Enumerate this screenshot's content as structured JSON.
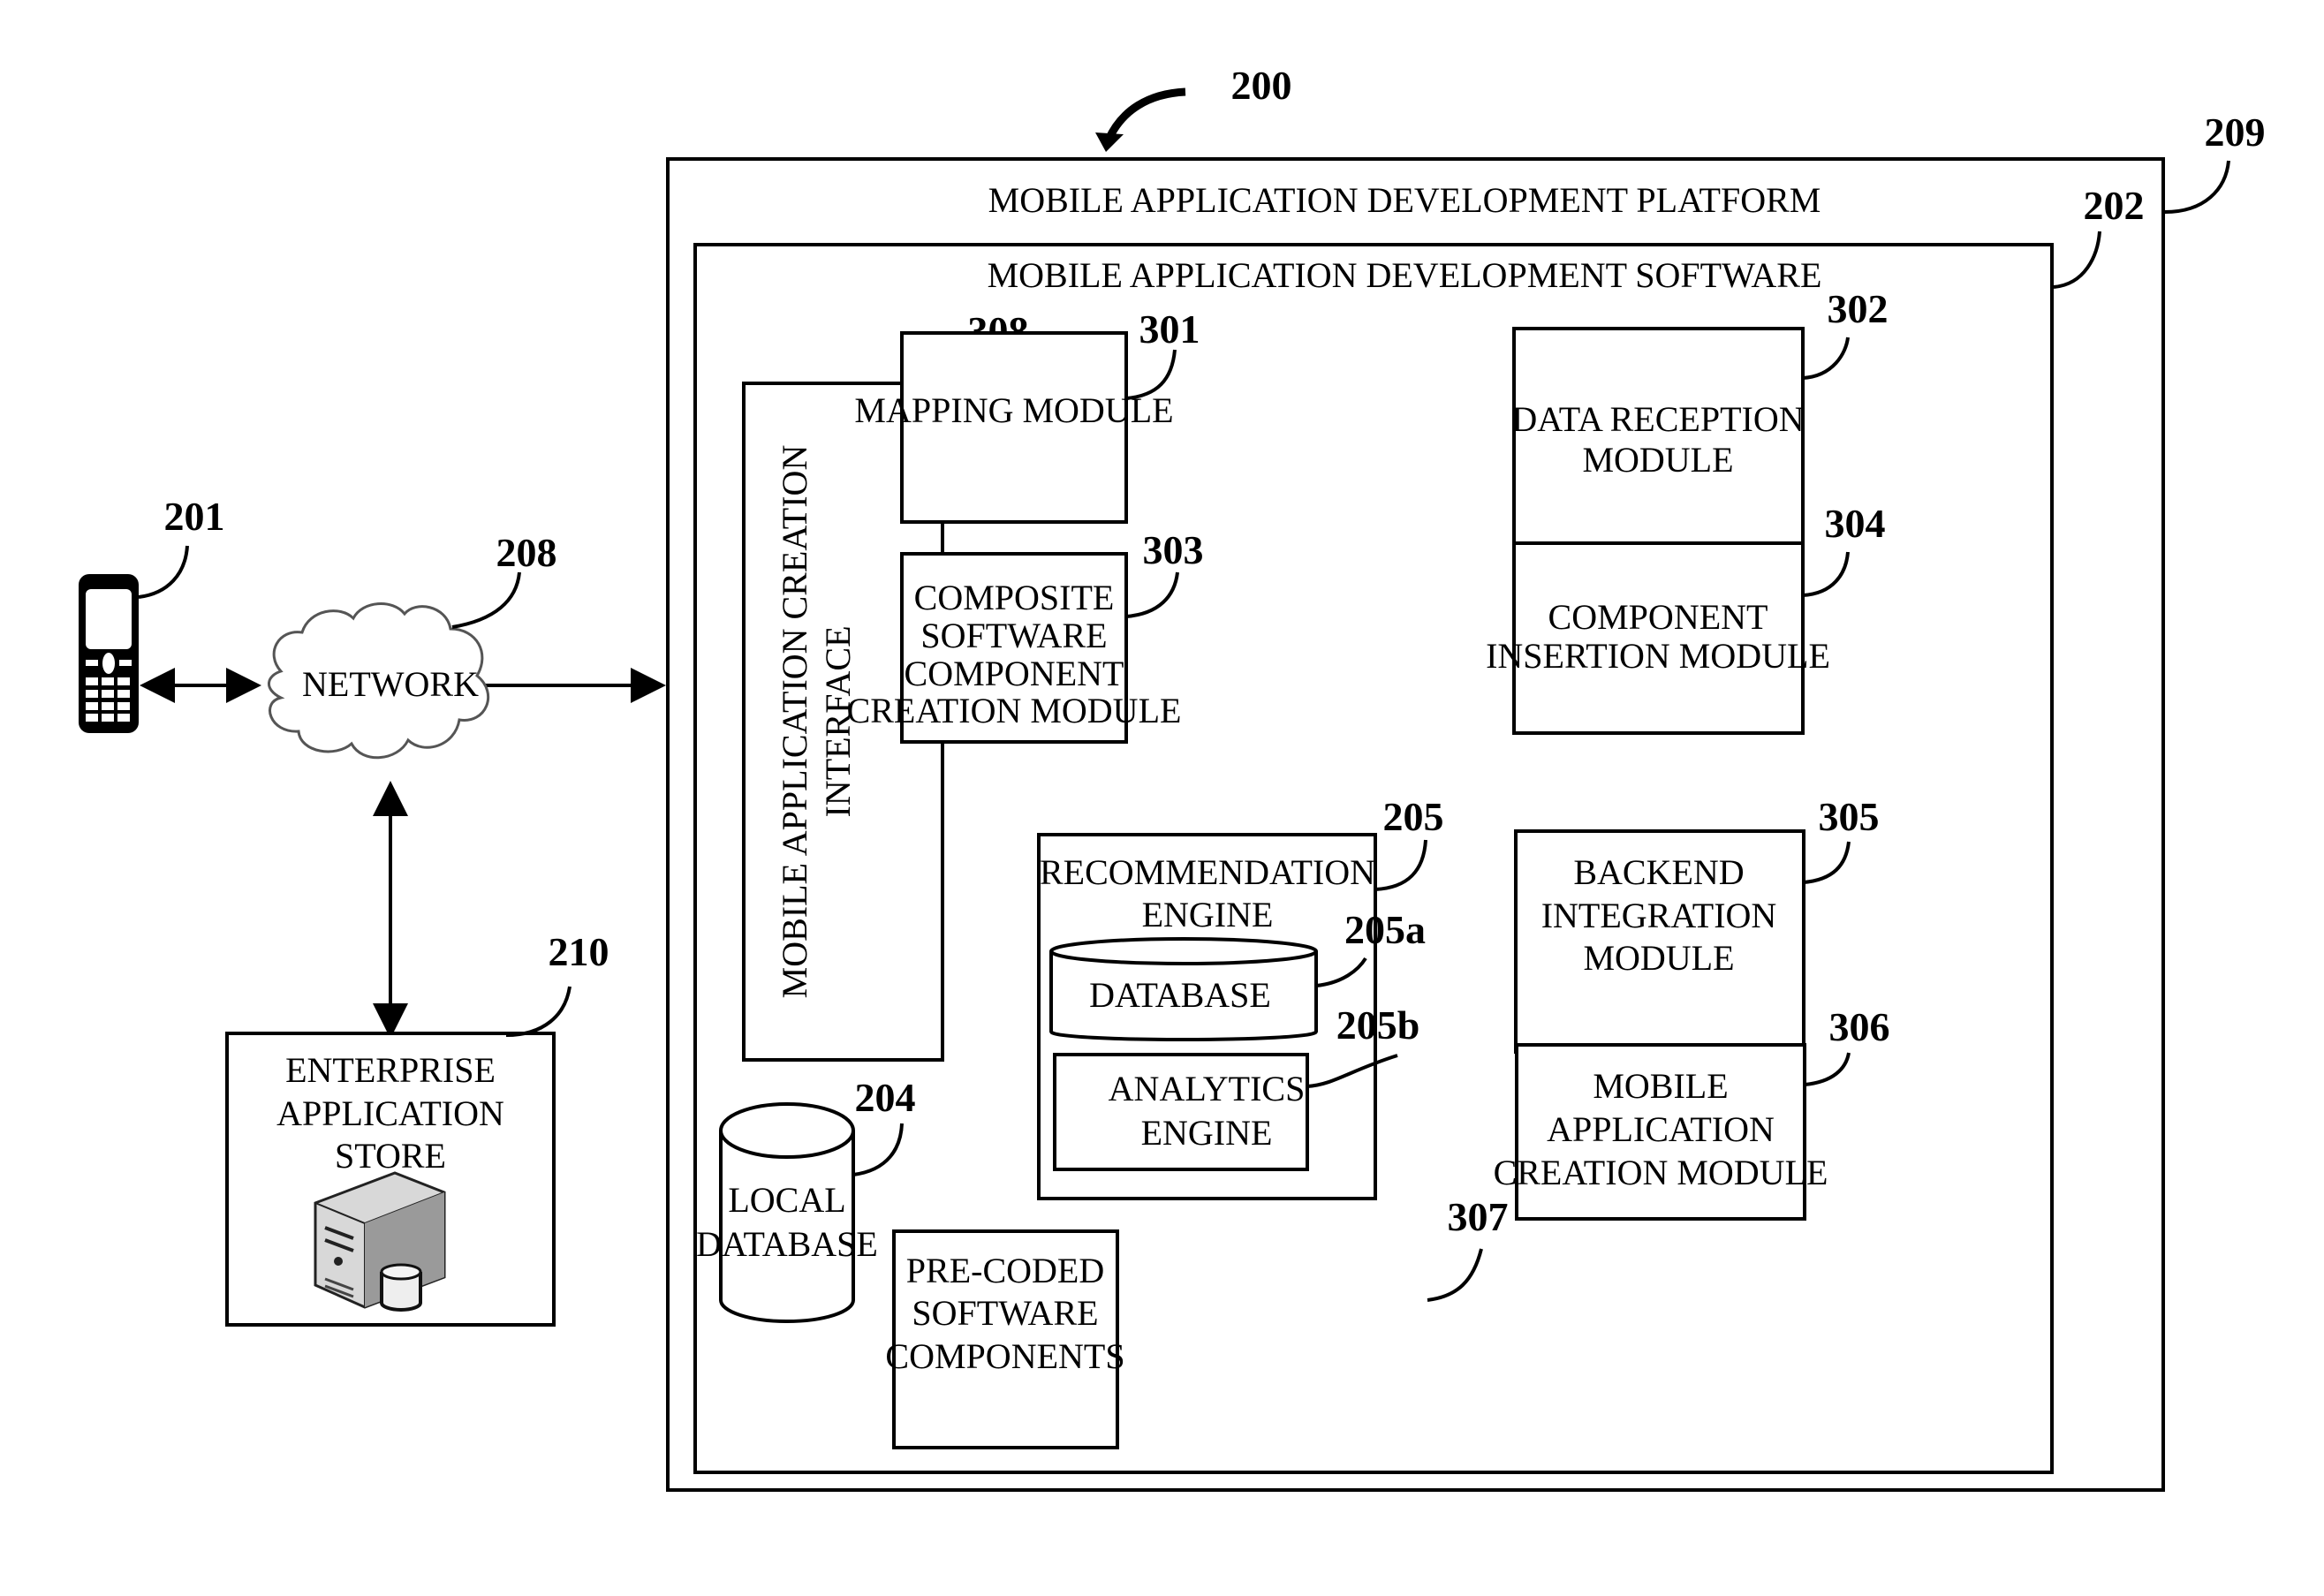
{
  "figure_ref": "200",
  "platform": {
    "ref": "209",
    "label": "MOBILE APPLICATION DEVELOPMENT PLATFORM"
  },
  "software": {
    "ref": "202",
    "label": "MOBILE APPLICATION DEVELOPMENT SOFTWARE"
  },
  "device": {
    "ref": "201",
    "icon": "mobile-phone-icon"
  },
  "network": {
    "ref": "208",
    "label": "NETWORK",
    "icon": "cloud-icon"
  },
  "store": {
    "ref": "210",
    "lines": [
      "ENTERPRISE",
      "APPLICATION",
      "STORE"
    ],
    "icon": "server-database-icon"
  },
  "interface": {
    "ref": "308",
    "lines": [
      "MOBILE APPLICATION CREATION",
      "INTERFACE"
    ]
  },
  "local_db": {
    "ref": "204",
    "lines": [
      "LOCAL",
      "DATABASE"
    ]
  },
  "modules": {
    "mapping": {
      "ref": "301",
      "lines": [
        "MAPPING MODULE"
      ]
    },
    "data_reception": {
      "ref": "302",
      "lines": [
        "DATA RECEPTION",
        "MODULE"
      ]
    },
    "composite": {
      "ref": "303",
      "lines": [
        "COMPOSITE",
        "SOFTWARE",
        "COMPONENT",
        "CREATION MODULE"
      ]
    },
    "component_insertion": {
      "ref": "304",
      "lines": [
        "COMPONENT",
        "INSERTION MODULE"
      ]
    },
    "recommendation": {
      "ref": "205",
      "lines": [
        "RECOMMENDATION",
        "ENGINE"
      ]
    },
    "rec_database": {
      "ref": "205a",
      "lines": [
        "DATABASE"
      ]
    },
    "analytics": {
      "ref": "205b",
      "lines": [
        "ANALYTICS",
        "ENGINE"
      ]
    },
    "backend": {
      "ref": "305",
      "lines": [
        "BACKEND",
        "INTEGRATION",
        "MODULE"
      ]
    },
    "mobile_app_creation": {
      "ref": "306",
      "lines": [
        "MOBILE",
        "APPLICATION",
        "CREATION MODULE"
      ]
    },
    "precoded": {
      "ref": "307",
      "lines": [
        "PRE-CODED",
        "SOFTWARE",
        "COMPONENTS"
      ]
    }
  }
}
